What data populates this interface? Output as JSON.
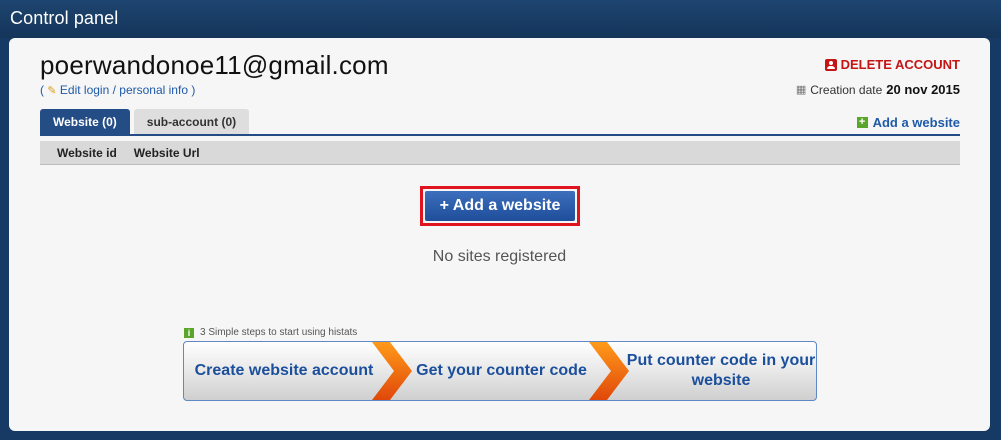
{
  "window": {
    "title": "Control panel"
  },
  "account": {
    "email": "poerwandonoe11@gmail.com",
    "edit_link": "Edit login / personal info",
    "paren_open": "( ",
    "paren_close": " )",
    "delete_label": "DELETE ACCOUNT",
    "creation_label": "Creation date",
    "creation_date": "20 nov 2015"
  },
  "tabs": [
    {
      "label": "Website (0)",
      "active": true
    },
    {
      "label": "sub-account (0)",
      "active": false
    }
  ],
  "add_website_link": "Add a website",
  "table": {
    "columns": [
      "Website id",
      "Website Url"
    ]
  },
  "main": {
    "add_button": "+ Add a website",
    "empty_text": "No sites registered"
  },
  "steps": {
    "label": "3 Simple steps to start using histats",
    "items": [
      "Create website account",
      "Get your counter code",
      "Put counter code in your website"
    ]
  },
  "colors": {
    "background": "#163a63",
    "accent": "#244d85",
    "delete": "#c41414",
    "highlight_border": "#e0141e",
    "step_arrow": "#f26a0c"
  }
}
